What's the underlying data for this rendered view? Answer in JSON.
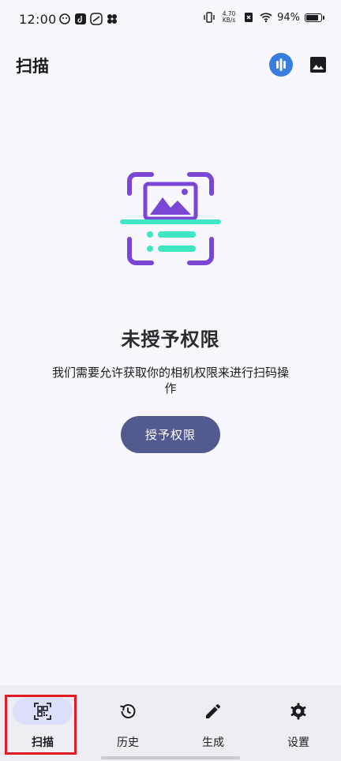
{
  "status_bar": {
    "time": "12:00",
    "net_speed_value": "4.70",
    "net_speed_unit": "KB/s",
    "battery_percent": "94%",
    "battery_level": 0.94
  },
  "app_bar": {
    "title": "扫描",
    "voice_icon": "voice-wave-icon",
    "gallery_icon": "image-gallery-icon"
  },
  "permission": {
    "illustration_icon": "scan-image-document-illustration",
    "headline": "未授予权限",
    "message": "我们需要允许获取你的相机权限来进行扫码操作",
    "button_label": "授予权限"
  },
  "bottom_nav": {
    "items": [
      {
        "label": "扫描",
        "icon": "qr-scan-icon",
        "active": true
      },
      {
        "label": "历史",
        "icon": "history-icon",
        "active": false
      },
      {
        "label": "生成",
        "icon": "pencil-icon",
        "active": false
      },
      {
        "label": "设置",
        "icon": "gear-icon",
        "active": false
      }
    ]
  },
  "colors": {
    "background": "#f8f7fd",
    "accent_blue": "#3a7de0",
    "button": "#535a8f",
    "illustration_purple": "#7a46d6",
    "illustration_teal": "#3ee6c4",
    "nav_background": "#eeedf4",
    "nav_active_pill": "#dcdffa",
    "highlight_red": "#e01b24"
  }
}
